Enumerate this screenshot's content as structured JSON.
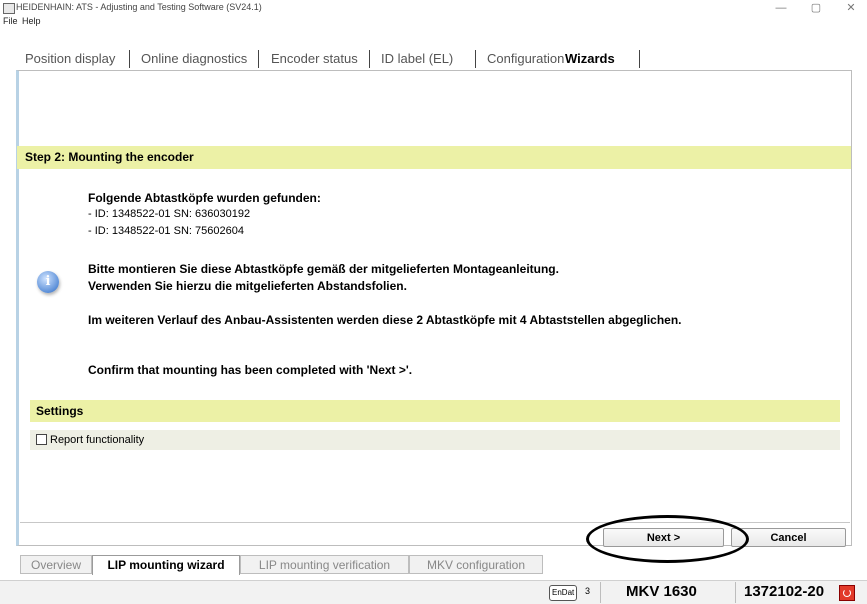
{
  "window": {
    "title": "HEIDENHAIN: ATS - Adjusting and Testing Software (SV24.1)",
    "minimize": "—",
    "maximize": "▢",
    "close": "✕"
  },
  "menu": [
    "File",
    "Help"
  ],
  "top_tabs": [
    "Position display",
    "Online diagnostics",
    "Encoder status",
    "ID label (EL)",
    "Configuration",
    "Wizards"
  ],
  "active_top_tab": "Wizards",
  "step": {
    "header": "Step 2: Mounting the encoder",
    "found_title": "Folgende Abtastköpfe wurden gefunden:",
    "found_items": [
      "- ID: 1348522-01  SN: 636030192",
      "- ID: 1348522-01  SN: 75602604"
    ],
    "instruction_1": "Bitte montieren Sie diese Abtastköpfe gemäß der mitgelieferten Montageanleitung.",
    "instruction_2": "Verwenden Sie hierzu die mitgelieferten Abstandsfolien.",
    "instruction_3": "Im weiteren Verlauf des Anbau-Assistenten werden diese 2 Abtastköpfe mit 4 Abtaststellen abgeglichen.",
    "confirm": "Confirm that mounting has been completed with 'Next >'.",
    "info_icon": "i"
  },
  "settings": {
    "header": "Settings",
    "report_label": "Report functionality",
    "report_checked": false
  },
  "buttons": {
    "next": "Next >",
    "cancel": "Cancel"
  },
  "bottom_tabs": [
    "Overview",
    "LIP mounting wizard",
    "LIP mounting verification",
    "MKV configuration"
  ],
  "active_bottom_tab": "LIP mounting wizard",
  "status": {
    "interface": "EnDat",
    "interface_version": "3",
    "model": "MKV 1630",
    "id": "1372102-20",
    "status_color": "#e23a2a"
  }
}
